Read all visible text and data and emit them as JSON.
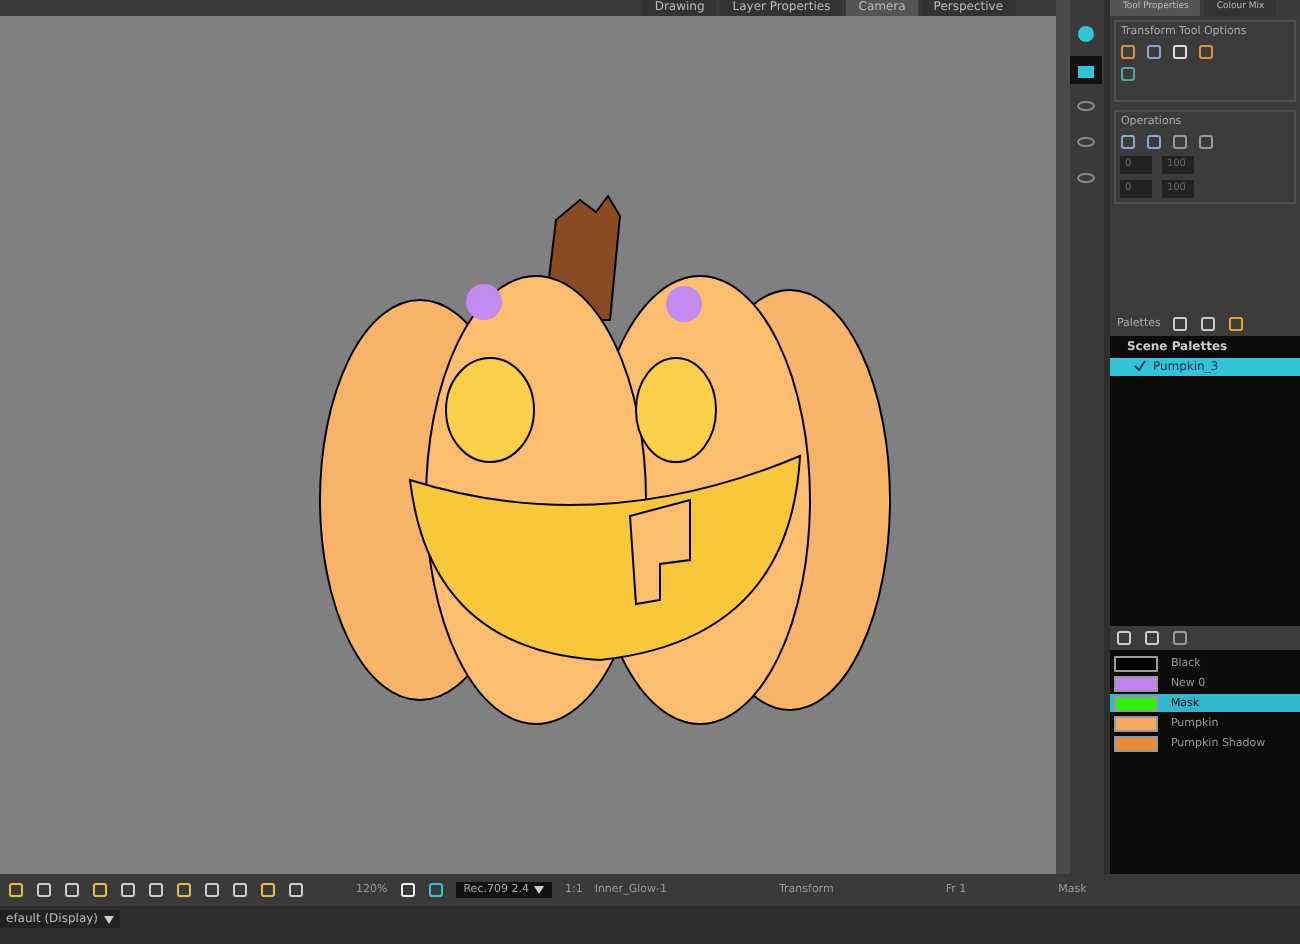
{
  "view_tabs": [
    {
      "label": "Drawing",
      "selected": false
    },
    {
      "label": "Layer Properties",
      "selected": false
    },
    {
      "label": "Camera",
      "selected": true
    },
    {
      "label": "Perspective",
      "selected": false
    }
  ],
  "panel_tabs": [
    {
      "label": "Tool Properties",
      "selected": true
    },
    {
      "label": "Colour Mix",
      "selected": false
    }
  ],
  "tool_options": {
    "title": "Transform Tool Options"
  },
  "operations": {
    "title": "Operations",
    "fields": [
      "0",
      "100",
      "0",
      "100"
    ]
  },
  "palettes": {
    "title": "Palettes",
    "header": "Scene Palettes",
    "items": [
      {
        "label": "Pumpkin_3",
        "selected": true,
        "checked": true
      }
    ]
  },
  "colours": [
    {
      "name": "Black",
      "color": "#000000",
      "selected": false
    },
    {
      "name": "New 0",
      "color": "#c384f2",
      "selected": false
    },
    {
      "name": "Mask",
      "color": "#33ee11",
      "selected": true
    },
    {
      "name": "Pumpkin",
      "color": "#f5a860",
      "selected": false
    },
    {
      "name": "Pumpkin Shadow",
      "color": "#e88c3c",
      "selected": false
    }
  ],
  "toolbar": {
    "zoom": "120%",
    "colour_space": "Rec.709 2.4",
    "ratio": "1:1",
    "node": "Inner_Glow-1"
  },
  "status": {
    "tool": "Transform",
    "frame": "Fr 1",
    "colour": "Mask"
  },
  "display": "efault (Display)"
}
